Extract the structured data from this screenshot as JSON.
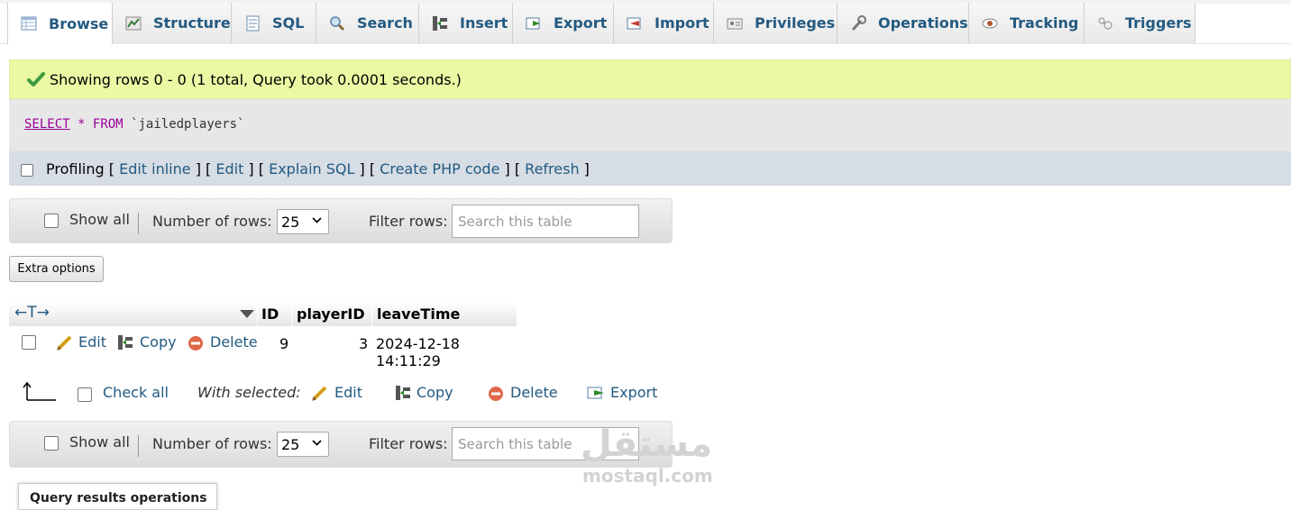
{
  "tabs": [
    {
      "label": "Browse",
      "icon": "browse-icon",
      "active": true
    },
    {
      "label": "Structure",
      "icon": "structure-icon"
    },
    {
      "label": "SQL",
      "icon": "sql-icon"
    },
    {
      "label": "Search",
      "icon": "search-icon"
    },
    {
      "label": "Insert",
      "icon": "insert-icon"
    },
    {
      "label": "Export",
      "icon": "export-icon"
    },
    {
      "label": "Import",
      "icon": "import-icon"
    },
    {
      "label": "Privileges",
      "icon": "privileges-icon"
    },
    {
      "label": "Operations",
      "icon": "operations-icon"
    },
    {
      "label": "Tracking",
      "icon": "tracking-icon"
    },
    {
      "label": "Triggers",
      "icon": "triggers-icon"
    }
  ],
  "message": {
    "text": "Showing rows 0 - 0 (1 total, Query took 0.0001 seconds.)"
  },
  "query": {
    "select": "SELECT",
    "star": "*",
    "from": "FROM",
    "table": "`jailedplayers`"
  },
  "tools": {
    "profiling": "Profiling",
    "edit_inline": "Edit inline",
    "edit": "Edit",
    "explain": "Explain SQL",
    "php": "Create PHP code",
    "refresh": "Refresh"
  },
  "nav": {
    "show_all": "Show all",
    "number_of_rows": "Number of rows:",
    "rows_value": "25",
    "filter_rows": "Filter rows:",
    "search_placeholder": "Search this table"
  },
  "extra_options": "Extra options",
  "table": {
    "arrows": "←T→",
    "columns": [
      "ID",
      "playerID",
      "leaveTime"
    ],
    "rows": [
      {
        "id": "9",
        "playerID": "3",
        "leaveTime": "2024-12-18 14:11:29"
      }
    ],
    "actions": {
      "edit": "Edit",
      "copy": "Copy",
      "delete": "Delete"
    }
  },
  "with_selected": {
    "check_all": "Check all",
    "label": "With selected:",
    "edit": "Edit",
    "copy": "Copy",
    "delete": "Delete",
    "export": "Export"
  },
  "bottom_section": "Query results operations",
  "watermark": {
    "arabic": "مستقل",
    "latin": "mostaql.com"
  },
  "colors": {
    "link": "#235a81",
    "success_bg": "#ebf8a4",
    "keyword": "#990099"
  }
}
